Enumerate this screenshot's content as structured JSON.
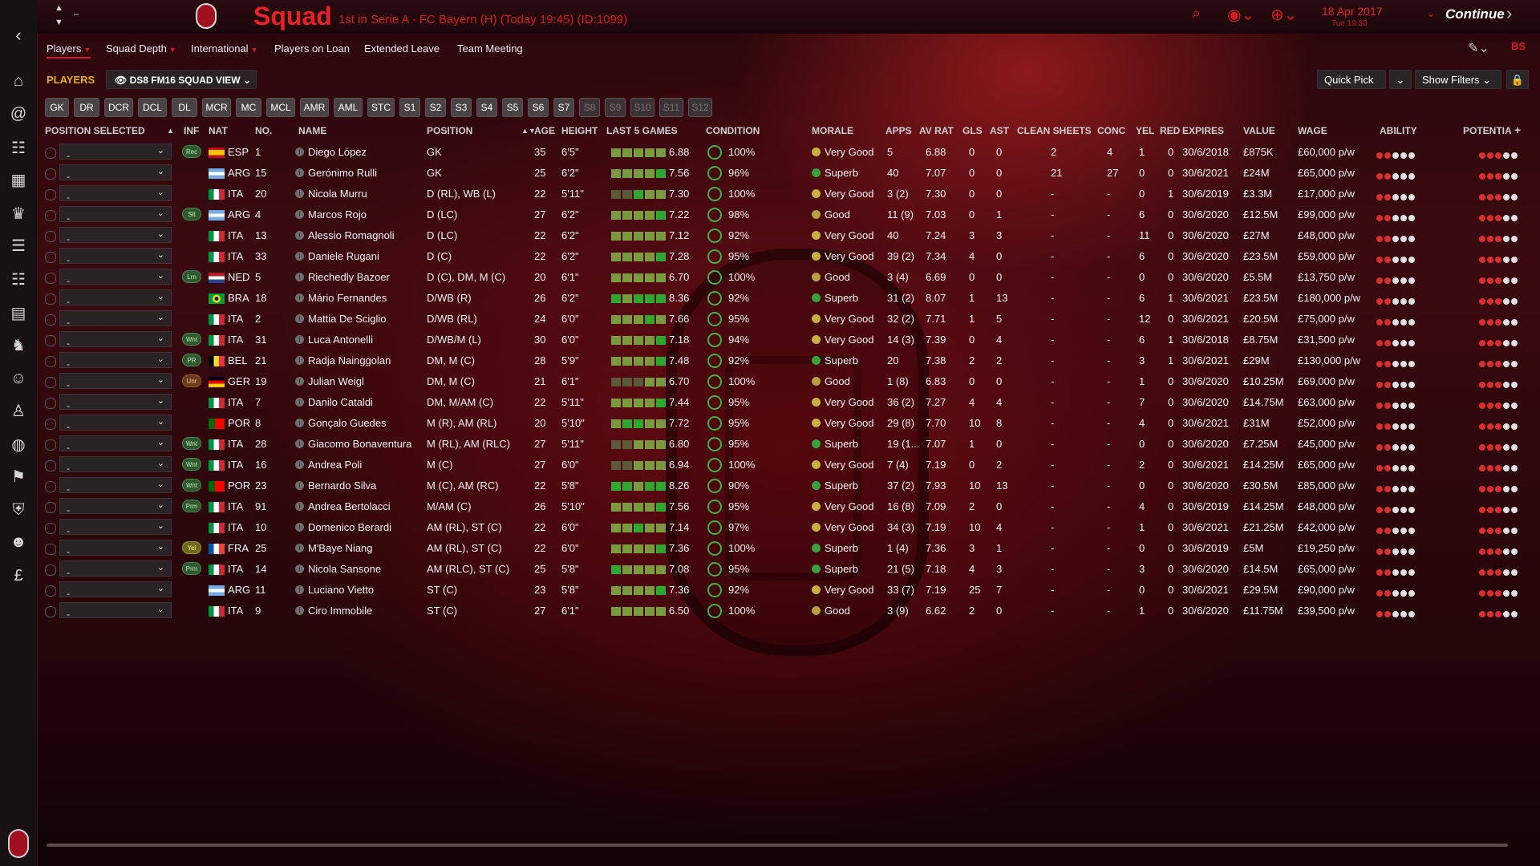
{
  "topbar": {
    "title": "Squad",
    "subtitle": "1st in Serie A - FC Bayern (H) (Today 19:45) (ID:1099)",
    "date": "18 Apr 2017",
    "time": "Tue 19:30",
    "continue_label": "Continue"
  },
  "menu": [
    "Players",
    "Squad Depth",
    "International",
    "Players on Loan",
    "Extended Leave",
    "Team Meeting"
  ],
  "toolbar": {
    "players_label": "PLAYERS",
    "view_label": "DS8 FM16 SQUAD VIEW",
    "quick_pick": "Quick Pick",
    "show_filters": "Show Filters"
  },
  "position_buttons": [
    "GK",
    "DR",
    "DCR",
    "DCL",
    "DL",
    "MCR",
    "MC",
    "MCL",
    "AMR",
    "AML",
    "STC",
    "S1",
    "S2",
    "S3",
    "S4",
    "S5",
    "S6",
    "S7",
    "S8",
    "S9",
    "S10",
    "S11",
    "S12"
  ],
  "headers": {
    "position_selected": "POSITION SELECTED",
    "inf": "INF",
    "nat": "NAT",
    "no": "NO.",
    "name": "NAME",
    "position": "POSITION",
    "age": "AGE",
    "height": "HEIGHT",
    "last5": "LAST 5 GAMES",
    "condition": "CONDITION",
    "morale": "MORALE",
    "apps": "APPS",
    "avrat": "AV RAT",
    "gls": "GLS",
    "ast": "AST",
    "clean_sheets": "CLEAN SHEETS",
    "conc": "CONC",
    "yel": "YEL",
    "red": "RED",
    "expires": "EXPIRES",
    "value": "VALUE",
    "wage": "WAGE",
    "ability": "ABILITY",
    "potential": "POTENTIA"
  },
  "colors": {
    "accent": "#d81c24",
    "good": "#44b044",
    "players_label": "#e8b000"
  },
  "players": [
    {
      "sel": "-",
      "inf": "Rec",
      "nat": "ESP",
      "no": "1",
      "name": "Diego López",
      "pos": "GK",
      "age": "35",
      "height": "6'5\"",
      "form": [
        1,
        1,
        1,
        1,
        1
      ],
      "form_rating": "6.88",
      "cond": "100%",
      "morale": "Very Good",
      "apps": "5",
      "avrat": "6.88",
      "gls": "0",
      "ast": "0",
      "cs": "2",
      "conc": "4",
      "yel": "1",
      "red": "0",
      "exp": "30/6/2018",
      "value": "£875K",
      "wage": "£60,000 p/w"
    },
    {
      "sel": "-",
      "inf": "",
      "nat": "ARG",
      "no": "15",
      "name": "Gerónimo Rulli",
      "pos": "GK",
      "age": "25",
      "height": "6'2\"",
      "form": [
        1,
        1,
        1,
        1,
        2
      ],
      "form_rating": "7.56",
      "cond": "96%",
      "morale": "Superb",
      "apps": "40",
      "avrat": "7.07",
      "gls": "0",
      "ast": "0",
      "cs": "21",
      "conc": "27",
      "yel": "0",
      "red": "0",
      "exp": "30/6/2021",
      "value": "£24M",
      "wage": "£65,000 p/w"
    },
    {
      "sel": "-",
      "inf": "",
      "nat": "ITA",
      "no": "20",
      "name": "Nicola Murru",
      "pos": "D (RL), WB (L)",
      "age": "22",
      "height": "5'11\"",
      "form": [
        0,
        0,
        2,
        1,
        1
      ],
      "form_rating": "7.30",
      "cond": "100%",
      "morale": "Very Good",
      "apps": "3 (2)",
      "avrat": "7.30",
      "gls": "0",
      "ast": "0",
      "cs": "-",
      "conc": "-",
      "yel": "0",
      "red": "1",
      "exp": "30/6/2019",
      "value": "£3.3M",
      "wage": "£17,000 p/w"
    },
    {
      "sel": "-",
      "inf": "Slt",
      "nat": "ARG",
      "no": "4",
      "name": "Marcos Rojo",
      "pos": "D (LC)",
      "age": "27",
      "height": "6'2\"",
      "form": [
        1,
        1,
        1,
        1,
        2
      ],
      "form_rating": "7.22",
      "cond": "98%",
      "morale": "Good",
      "apps": "11 (9)",
      "avrat": "7.03",
      "gls": "0",
      "ast": "1",
      "cs": "-",
      "conc": "-",
      "yel": "6",
      "red": "0",
      "exp": "30/6/2020",
      "value": "£12.5M",
      "wage": "£99,000 p/w"
    },
    {
      "sel": "-",
      "inf": "",
      "nat": "ITA",
      "no": "13",
      "name": "Alessio Romagnoli",
      "pos": "D (LC)",
      "age": "22",
      "height": "6'2\"",
      "form": [
        1,
        1,
        1,
        1,
        1
      ],
      "form_rating": "7.12",
      "cond": "92%",
      "morale": "Very Good",
      "apps": "40",
      "avrat": "7.24",
      "gls": "3",
      "ast": "3",
      "cs": "-",
      "conc": "-",
      "yel": "11",
      "red": "0",
      "exp": "30/6/2020",
      "value": "£27M",
      "wage": "£48,000 p/w"
    },
    {
      "sel": "-",
      "inf": "",
      "nat": "ITA",
      "no": "33",
      "name": "Daniele Rugani",
      "pos": "D (C)",
      "age": "22",
      "height": "6'2\"",
      "form": [
        1,
        1,
        1,
        1,
        2
      ],
      "form_rating": "7.28",
      "cond": "95%",
      "morale": "Very Good",
      "apps": "39 (2)",
      "avrat": "7.34",
      "gls": "4",
      "ast": "0",
      "cs": "-",
      "conc": "-",
      "yel": "6",
      "red": "0",
      "exp": "30/6/2020",
      "value": "£23.5M",
      "wage": "£59,000 p/w"
    },
    {
      "sel": "-",
      "inf": "Lrn",
      "nat": "NED",
      "no": "5",
      "name": "Riechedly Bazoer",
      "pos": "D (C), DM, M (C)",
      "age": "20",
      "height": "6'1\"",
      "form": [
        1,
        1,
        1,
        1,
        1
      ],
      "form_rating": "6.70",
      "cond": "100%",
      "morale": "Good",
      "apps": "3 (4)",
      "avrat": "6.69",
      "gls": "0",
      "ast": "0",
      "cs": "-",
      "conc": "-",
      "yel": "0",
      "red": "0",
      "exp": "30/6/2020",
      "value": "£5.5M",
      "wage": "£13,750 p/w"
    },
    {
      "sel": "-",
      "inf": "",
      "nat": "BRA",
      "no": "18",
      "name": "Mário Fernandes",
      "pos": "D/WB (R)",
      "age": "26",
      "height": "6'2\"",
      "form": [
        2,
        1,
        2,
        2,
        2
      ],
      "form_rating": "8.36",
      "cond": "92%",
      "morale": "Superb",
      "apps": "31 (2)",
      "avrat": "8.07",
      "gls": "1",
      "ast": "13",
      "cs": "-",
      "conc": "-",
      "yel": "6",
      "red": "1",
      "exp": "30/6/2021",
      "value": "£23.5M",
      "wage": "£180,000 p/w"
    },
    {
      "sel": "-",
      "inf": "",
      "nat": "ITA",
      "no": "2",
      "name": "Mattia De Sciglio",
      "pos": "D/WB (RL)",
      "age": "24",
      "height": "6'0\"",
      "form": [
        1,
        1,
        1,
        2,
        1
      ],
      "form_rating": "7.66",
      "cond": "95%",
      "morale": "Very Good",
      "apps": "32 (2)",
      "avrat": "7.71",
      "gls": "1",
      "ast": "5",
      "cs": "-",
      "conc": "-",
      "yel": "12",
      "red": "0",
      "exp": "30/6/2021",
      "value": "£20.5M",
      "wage": "£75,000 p/w"
    },
    {
      "sel": "-",
      "inf": "Wnt",
      "nat": "ITA",
      "no": "31",
      "name": "Luca Antonelli",
      "pos": "D/WB/M (L)",
      "age": "30",
      "height": "6'0\"",
      "form": [
        1,
        1,
        1,
        1,
        2
      ],
      "form_rating": "7.18",
      "cond": "94%",
      "morale": "Very Good",
      "apps": "14 (3)",
      "avrat": "7.39",
      "gls": "0",
      "ast": "4",
      "cs": "-",
      "conc": "-",
      "yel": "6",
      "red": "1",
      "exp": "30/6/2018",
      "value": "£8.75M",
      "wage": "£31,500 p/w"
    },
    {
      "sel": "-",
      "inf": "PR",
      "nat": "BEL",
      "no": "21",
      "name": "Radja Nainggolan",
      "pos": "DM, M (C)",
      "age": "28",
      "height": "5'9\"",
      "form": [
        1,
        1,
        1,
        1,
        2
      ],
      "form_rating": "7.48",
      "cond": "92%",
      "morale": "Superb",
      "apps": "20",
      "avrat": "7.38",
      "gls": "2",
      "ast": "2",
      "cs": "-",
      "conc": "-",
      "yel": "3",
      "red": "1",
      "exp": "30/6/2021",
      "value": "£29M",
      "wage": "£130,000 p/w"
    },
    {
      "sel": "-",
      "inf": "Unr",
      "nat": "GER",
      "no": "19",
      "name": "Julian Weigl",
      "pos": "DM, M (C)",
      "age": "21",
      "height": "6'1\"",
      "form": [
        0,
        0,
        0,
        1,
        1
      ],
      "form_rating": "6.70",
      "cond": "100%",
      "morale": "Good",
      "apps": "1 (8)",
      "avrat": "6.83",
      "gls": "0",
      "ast": "0",
      "cs": "-",
      "conc": "-",
      "yel": "1",
      "red": "0",
      "exp": "30/6/2020",
      "value": "£10.25M",
      "wage": "£69,000 p/w"
    },
    {
      "sel": "-",
      "inf": "",
      "nat": "ITA",
      "no": "7",
      "name": "Danilo Cataldi",
      "pos": "DM, M/AM (C)",
      "age": "22",
      "height": "5'11\"",
      "form": [
        1,
        1,
        1,
        1,
        2
      ],
      "form_rating": "7.44",
      "cond": "95%",
      "morale": "Very Good",
      "apps": "36 (2)",
      "avrat": "7.27",
      "gls": "4",
      "ast": "4",
      "cs": "-",
      "conc": "-",
      "yel": "7",
      "red": "0",
      "exp": "30/6/2020",
      "value": "£14.75M",
      "wage": "£63,000 p/w"
    },
    {
      "sel": "-",
      "inf": "",
      "nat": "POR",
      "no": "8",
      "name": "Gonçalo Guedes",
      "pos": "M (R), AM (RL)",
      "age": "20",
      "height": "5'10\"",
      "form": [
        1,
        2,
        2,
        1,
        1
      ],
      "form_rating": "7.72",
      "cond": "95%",
      "morale": "Very Good",
      "apps": "29 (8)",
      "avrat": "7.70",
      "gls": "10",
      "ast": "8",
      "cs": "-",
      "conc": "-",
      "yel": "4",
      "red": "0",
      "exp": "30/6/2021",
      "value": "£31M",
      "wage": "£52,000 p/w"
    },
    {
      "sel": "-",
      "inf": "Wnt",
      "nat": "ITA",
      "no": "28",
      "name": "Giacomo Bonaventura",
      "pos": "M (RL), AM (RLC)",
      "age": "27",
      "height": "5'11\"",
      "form": [
        0,
        0,
        1,
        1,
        1
      ],
      "form_rating": "6.80",
      "cond": "95%",
      "morale": "Superb",
      "apps": "19 (1...",
      "avrat": "7.07",
      "gls": "1",
      "ast": "0",
      "cs": "-",
      "conc": "-",
      "yel": "0",
      "red": "0",
      "exp": "30/6/2020",
      "value": "£7.25M",
      "wage": "£45,000 p/w"
    },
    {
      "sel": "-",
      "inf": "Wnt",
      "nat": "ITA",
      "no": "16",
      "name": "Andrea Poli",
      "pos": "M (C)",
      "age": "27",
      "height": "6'0\"",
      "form": [
        0,
        0,
        1,
        1,
        1
      ],
      "form_rating": "6.94",
      "cond": "100%",
      "morale": "Very Good",
      "apps": "7 (4)",
      "avrat": "7.19",
      "gls": "0",
      "ast": "2",
      "cs": "-",
      "conc": "-",
      "yel": "2",
      "red": "0",
      "exp": "30/6/2021",
      "value": "£14.25M",
      "wage": "£65,000 p/w"
    },
    {
      "sel": "-",
      "inf": "Wnt",
      "nat": "POR",
      "no": "23",
      "name": "Bernardo Silva",
      "pos": "M (C), AM (RC)",
      "age": "22",
      "height": "5'8\"",
      "form": [
        2,
        2,
        1,
        2,
        2
      ],
      "form_rating": "8.26",
      "cond": "90%",
      "morale": "Superb",
      "apps": "37 (2)",
      "avrat": "7.93",
      "gls": "10",
      "ast": "13",
      "cs": "-",
      "conc": "-",
      "yel": "0",
      "red": "0",
      "exp": "30/6/2020",
      "value": "£30.5M",
      "wage": "£85,000 p/w"
    },
    {
      "sel": "-",
      "inf": "Prm",
      "nat": "ITA",
      "no": "91",
      "name": "Andrea Bertolacci",
      "pos": "M/AM (C)",
      "age": "26",
      "height": "5'10\"",
      "form": [
        1,
        1,
        1,
        1,
        2
      ],
      "form_rating": "7.56",
      "cond": "95%",
      "morale": "Very Good",
      "apps": "16 (8)",
      "avrat": "7.09",
      "gls": "2",
      "ast": "0",
      "cs": "-",
      "conc": "-",
      "yel": "4",
      "red": "0",
      "exp": "30/6/2019",
      "value": "£14.25M",
      "wage": "£48,000 p/w"
    },
    {
      "sel": "-",
      "inf": "",
      "nat": "ITA",
      "no": "10",
      "name": "Domenico Berardi",
      "pos": "AM (RL), ST (C)",
      "age": "22",
      "height": "6'0\"",
      "form": [
        1,
        1,
        2,
        1,
        1
      ],
      "form_rating": "7.14",
      "cond": "97%",
      "morale": "Very Good",
      "apps": "34 (3)",
      "avrat": "7.19",
      "gls": "10",
      "ast": "4",
      "cs": "-",
      "conc": "-",
      "yel": "1",
      "red": "0",
      "exp": "30/6/2021",
      "value": "£21.25M",
      "wage": "£42,000 p/w"
    },
    {
      "sel": "-",
      "inf": "Yel",
      "nat": "FRA",
      "no": "25",
      "name": "M'Baye Niang",
      "pos": "AM (RL), ST (C)",
      "age": "22",
      "height": "6'0\"",
      "form": [
        1,
        1,
        1,
        1,
        2
      ],
      "form_rating": "7.36",
      "cond": "100%",
      "morale": "Superb",
      "apps": "1 (4)",
      "avrat": "7.36",
      "gls": "3",
      "ast": "1",
      "cs": "-",
      "conc": "-",
      "yel": "0",
      "red": "0",
      "exp": "30/6/2019",
      "value": "£5M",
      "wage": "£19,250 p/w"
    },
    {
      "sel": "-",
      "inf": "Prm",
      "nat": "ITA",
      "no": "14",
      "name": "Nicola Sansone",
      "pos": "AM (RLC), ST (C)",
      "age": "25",
      "height": "5'8\"",
      "form": [
        2,
        1,
        1,
        1,
        1
      ],
      "form_rating": "7.08",
      "cond": "95%",
      "morale": "Superb",
      "apps": "21 (5)",
      "avrat": "7.18",
      "gls": "4",
      "ast": "3",
      "cs": "-",
      "conc": "-",
      "yel": "3",
      "red": "0",
      "exp": "30/6/2020",
      "value": "£14.5M",
      "wage": "£65,000 p/w"
    },
    {
      "sel": "-",
      "inf": "",
      "nat": "ARG",
      "no": "11",
      "name": "Luciano Vietto",
      "pos": "ST (C)",
      "age": "23",
      "height": "5'8\"",
      "form": [
        1,
        1,
        1,
        1,
        2
      ],
      "form_rating": "7.36",
      "cond": "92%",
      "morale": "Very Good",
      "apps": "33 (7)",
      "avrat": "7.19",
      "gls": "25",
      "ast": "7",
      "cs": "-",
      "conc": "-",
      "yel": "0",
      "red": "0",
      "exp": "30/6/2021",
      "value": "£29.5M",
      "wage": "£90,000 p/w"
    },
    {
      "sel": "-",
      "inf": "",
      "nat": "ITA",
      "no": "9",
      "name": "Ciro Immobile",
      "pos": "ST (C)",
      "age": "27",
      "height": "6'1\"",
      "form": [
        1,
        1,
        1,
        1,
        1
      ],
      "form_rating": "6.50",
      "cond": "100%",
      "morale": "Good",
      "apps": "3 (9)",
      "avrat": "6.62",
      "gls": "2",
      "ast": "0",
      "cs": "-",
      "conc": "-",
      "yel": "1",
      "red": "0",
      "exp": "30/6/2020",
      "value": "£11.75M",
      "wage": "£39,500 p/w"
    }
  ]
}
